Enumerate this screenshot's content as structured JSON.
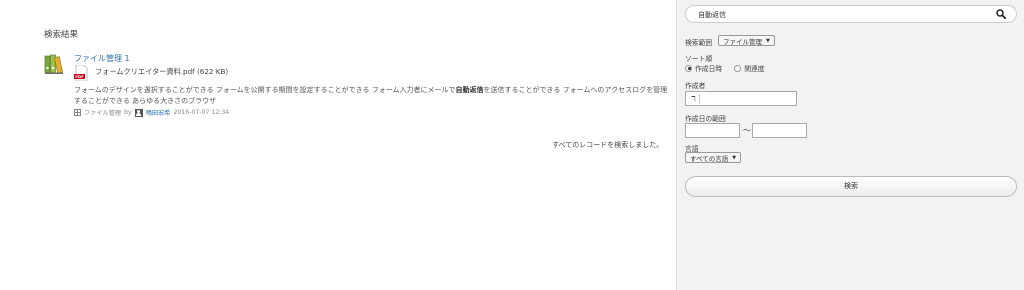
{
  "results": {
    "title": "検索結果",
    "items": [
      {
        "title": "ファイル管理 1",
        "file_name": "フォームクリエイター資料.pdf (622 KB)",
        "snippet_before": "フォームのデザインを選択することができる フォームを公開する期間を設定することができる フォーム入力者にメールで",
        "snippet_highlight": "自動返信",
        "snippet_after": "を送信することができる フォームへのアクセスログを管理することができる あらゆる大きさのブラウザ",
        "category": "ファイル管理",
        "by": "by",
        "author": "鳴田宏希",
        "timestamp": "2016-07-07 12:34"
      }
    ],
    "all_records_text": "すべてのレコードを検索しました。"
  },
  "sidebar": {
    "search_value": "自動返信",
    "scope_label": "検索範囲",
    "scope_value": "ファイル管理",
    "sort_label": "ソート順",
    "sort_options": [
      "作成日時",
      "関連度"
    ],
    "sort_selected": "作成日時",
    "creator_label": "作成者",
    "creator_button": "ℸ",
    "date_label": "作成日の範囲",
    "date_separator": "〜",
    "language_label": "言語",
    "language_value": "すべての言語",
    "search_button": "検索"
  }
}
